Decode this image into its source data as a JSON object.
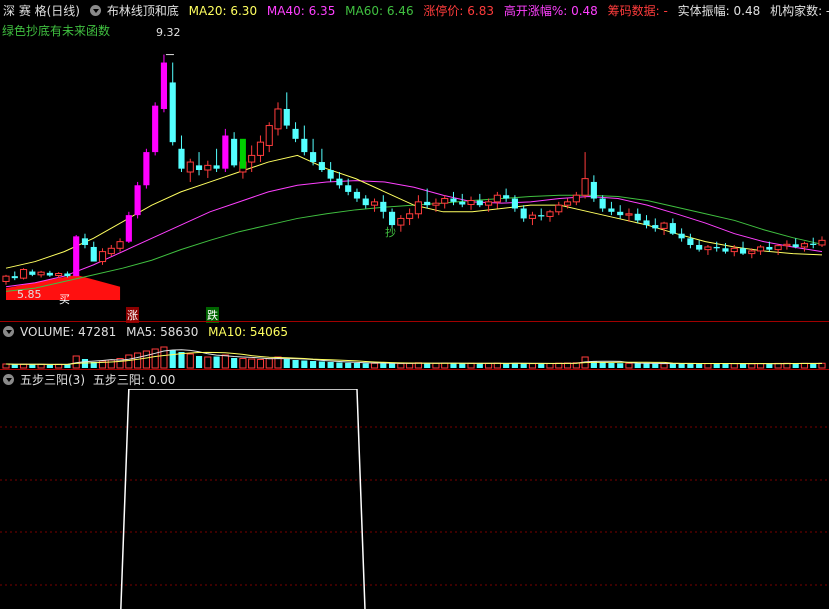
{
  "window": {
    "title": "深 赛 格(日线)"
  },
  "main_header": {
    "indicator": "布林线顶和底",
    "ma20": "MA20: 6.30",
    "ma40": "MA40: 6.35",
    "ma60": "MA60: 6.46",
    "limit_price": "涨停价: 6.83",
    "gap_pct": "高开涨幅%: 0.48",
    "chips": "筹码数据: -",
    "body_amp": "实体振幅: 0.48",
    "inst": "机构家数: -"
  },
  "main_note": "绿色抄底有未来函数",
  "colors": {
    "up": "#ff3c3c",
    "down": "#54ffff",
    "ma20": "#ffff60",
    "ma40": "#ff40ff",
    "ma60": "#40c040",
    "strong_up": "#ff00ff",
    "vol_ma10": "#ffff60"
  },
  "annotations": {
    "high": "9.32",
    "low": "5.85",
    "buy": "买",
    "rise": "涨",
    "fall": "跌",
    "bottom": "抄"
  },
  "volume_header": {
    "title": "VOLUME: 47281",
    "ma5": "MA5: 58630",
    "ma10": "MA10: 54065"
  },
  "sub_header": {
    "title": "五步三阳(3)",
    "value": "五步三阳: 0.00"
  },
  "chart_data": [
    {
      "type": "candlestick",
      "ylim": [
        5.5,
        9.6
      ],
      "ohlc": [
        [
          5.9,
          6.0,
          5.85,
          5.98
        ],
        [
          5.98,
          6.05,
          5.92,
          5.95
        ],
        [
          5.95,
          6.1,
          5.93,
          6.08
        ],
        [
          6.05,
          6.08,
          5.98,
          6.0
        ],
        [
          6.0,
          6.06,
          5.96,
          6.04
        ],
        [
          6.03,
          6.06,
          5.97,
          5.99
        ],
        [
          5.99,
          6.04,
          5.95,
          6.02
        ],
        [
          6.02,
          6.05,
          5.96,
          5.98
        ],
        [
          5.98,
          6.6,
          5.98,
          6.58
        ],
        [
          6.55,
          6.62,
          6.4,
          6.45
        ],
        [
          6.42,
          6.5,
          6.35,
          6.2
        ],
        [
          6.2,
          6.4,
          6.15,
          6.35
        ],
        [
          6.32,
          6.45,
          6.28,
          6.4
        ],
        [
          6.4,
          6.55,
          6.35,
          6.5
        ],
        [
          6.5,
          6.95,
          6.48,
          6.9
        ],
        [
          6.9,
          7.4,
          6.85,
          7.35
        ],
        [
          7.35,
          7.9,
          7.3,
          7.85
        ],
        [
          7.85,
          8.6,
          7.8,
          8.55
        ],
        [
          8.5,
          9.32,
          8.45,
          9.2
        ],
        [
          8.9,
          9.2,
          7.95,
          8.0
        ],
        [
          7.9,
          8.1,
          7.55,
          7.6
        ],
        [
          7.55,
          7.75,
          7.4,
          7.7
        ],
        [
          7.65,
          7.85,
          7.5,
          7.58
        ],
        [
          7.58,
          7.72,
          7.46,
          7.65
        ],
        [
          7.65,
          7.9,
          7.55,
          7.6
        ],
        [
          7.6,
          8.2,
          7.55,
          8.1
        ],
        [
          8.05,
          8.15,
          7.62,
          7.65
        ],
        [
          7.55,
          7.8,
          7.45,
          7.7
        ],
        [
          7.7,
          7.95,
          7.55,
          7.8
        ],
        [
          7.8,
          8.1,
          7.7,
          8.0
        ],
        [
          7.95,
          8.3,
          7.85,
          8.25
        ],
        [
          8.2,
          8.6,
          8.1,
          8.5
        ],
        [
          8.5,
          8.75,
          8.2,
          8.25
        ],
        [
          8.2,
          8.3,
          8.0,
          8.05
        ],
        [
          8.05,
          8.25,
          7.8,
          7.85
        ],
        [
          7.85,
          8.05,
          7.65,
          7.7
        ],
        [
          7.7,
          7.9,
          7.55,
          7.58
        ],
        [
          7.58,
          7.7,
          7.4,
          7.45
        ],
        [
          7.45,
          7.55,
          7.3,
          7.35
        ],
        [
          7.35,
          7.45,
          7.2,
          7.25
        ],
        [
          7.25,
          7.3,
          7.1,
          7.15
        ],
        [
          7.15,
          7.2,
          7.0,
          7.05
        ],
        [
          7.05,
          7.15,
          6.95,
          7.1
        ],
        [
          7.1,
          7.2,
          6.85,
          6.95
        ],
        [
          6.95,
          7.0,
          6.7,
          6.75
        ],
        [
          6.75,
          6.9,
          6.65,
          6.85
        ],
        [
          6.85,
          7.0,
          6.75,
          6.92
        ],
        [
          6.92,
          7.2,
          6.85,
          7.1
        ],
        [
          7.1,
          7.3,
          7.0,
          7.05
        ],
        [
          7.05,
          7.15,
          6.95,
          7.08
        ],
        [
          7.08,
          7.2,
          7.0,
          7.15
        ],
        [
          7.15,
          7.25,
          7.05,
          7.1
        ],
        [
          7.1,
          7.22,
          7.02,
          7.06
        ],
        [
          7.06,
          7.18,
          6.98,
          7.12
        ],
        [
          7.12,
          7.22,
          7.02,
          7.05
        ],
        [
          7.05,
          7.15,
          6.95,
          7.1
        ],
        [
          7.1,
          7.25,
          7.0,
          7.2
        ],
        [
          7.2,
          7.3,
          7.1,
          7.15
        ],
        [
          7.15,
          7.2,
          6.95,
          7.0
        ],
        [
          7.0,
          7.05,
          6.8,
          6.85
        ],
        [
          6.85,
          6.95,
          6.75,
          6.9
        ],
        [
          6.9,
          7.0,
          6.82,
          6.88
        ],
        [
          6.88,
          6.98,
          6.8,
          6.95
        ],
        [
          6.95,
          7.1,
          6.9,
          7.05
        ],
        [
          7.05,
          7.15,
          7.0,
          7.1
        ],
        [
          7.1,
          7.25,
          7.05,
          7.2
        ],
        [
          7.2,
          7.85,
          7.15,
          7.45
        ],
        [
          7.4,
          7.5,
          7.1,
          7.15
        ],
        [
          7.15,
          7.2,
          6.95,
          7.0
        ],
        [
          7.0,
          7.1,
          6.9,
          6.95
        ],
        [
          6.95,
          7.05,
          6.85,
          6.9
        ],
        [
          6.9,
          7.0,
          6.8,
          6.92
        ],
        [
          6.92,
          7.0,
          6.78,
          6.82
        ],
        [
          6.82,
          6.9,
          6.7,
          6.75
        ],
        [
          6.75,
          6.85,
          6.65,
          6.7
        ],
        [
          6.7,
          6.8,
          6.6,
          6.78
        ],
        [
          6.78,
          6.85,
          6.6,
          6.62
        ],
        [
          6.62,
          6.7,
          6.5,
          6.55
        ],
        [
          6.55,
          6.62,
          6.4,
          6.45
        ],
        [
          6.45,
          6.52,
          6.35,
          6.38
        ],
        [
          6.38,
          6.45,
          6.3,
          6.42
        ],
        [
          6.42,
          6.5,
          6.35,
          6.4
        ],
        [
          6.4,
          6.48,
          6.32,
          6.35
        ],
        [
          6.35,
          6.45,
          6.28,
          6.4
        ],
        [
          6.4,
          6.5,
          6.3,
          6.32
        ],
        [
          6.32,
          6.4,
          6.25,
          6.36
        ],
        [
          6.36,
          6.45,
          6.3,
          6.42
        ],
        [
          6.42,
          6.5,
          6.35,
          6.38
        ],
        [
          6.38,
          6.46,
          6.3,
          6.44
        ],
        [
          6.44,
          6.52,
          6.38,
          6.46
        ],
        [
          6.46,
          6.55,
          6.4,
          6.42
        ],
        [
          6.42,
          6.5,
          6.35,
          6.47
        ],
        [
          6.47,
          6.56,
          6.4,
          6.45
        ],
        [
          6.45,
          6.58,
          6.42,
          6.52
        ]
      ],
      "ma20_line": [
        6.1,
        6.2,
        6.35,
        6.55,
        6.8,
        7.05,
        7.25,
        7.4,
        7.55,
        7.7,
        7.8,
        7.6,
        7.45,
        7.25,
        7.05,
        6.95,
        6.95,
        7.0,
        7.05,
        7.05,
        6.95,
        6.85,
        6.75,
        6.62,
        6.5,
        6.42,
        6.36,
        6.32,
        6.3
      ],
      "ma40_line": [
        5.82,
        5.88,
        5.98,
        6.15,
        6.35,
        6.55,
        6.75,
        6.95,
        7.1,
        7.25,
        7.35,
        7.4,
        7.42,
        7.4,
        7.32,
        7.2,
        7.1,
        7.08,
        7.1,
        7.15,
        7.18,
        7.15,
        7.05,
        6.92,
        6.78,
        6.62,
        6.5,
        6.42,
        6.35
      ],
      "ma60_line": [
        5.75,
        5.8,
        5.9,
        6.0,
        6.1,
        6.22,
        6.38,
        6.52,
        6.65,
        6.75,
        6.85,
        6.92,
        6.98,
        7.02,
        7.05,
        7.08,
        7.12,
        7.15,
        7.18,
        7.2,
        7.2,
        7.18,
        7.12,
        7.02,
        6.92,
        6.82,
        6.68,
        6.56,
        6.46
      ]
    },
    {
      "type": "bar",
      "title": "VOLUME: 47281",
      "ylim": [
        0,
        260000
      ],
      "values": [
        40000,
        36000,
        38000,
        35000,
        36000,
        34000,
        36000,
        38000,
        120000,
        90000,
        60000,
        70000,
        80000,
        95000,
        130000,
        150000,
        170000,
        190000,
        210000,
        180000,
        160000,
        140000,
        120000,
        110000,
        115000,
        130000,
        100000,
        95000,
        90000,
        85000,
        95000,
        110000,
        90000,
        80000,
        75000,
        70000,
        65000,
        60000,
        55000,
        52000,
        50000,
        48000,
        47000,
        50000,
        45000,
        44000,
        46000,
        52000,
        49000,
        47000,
        48000,
        46000,
        45000,
        47000,
        46000,
        45000,
        48000,
        47000,
        50000,
        45000,
        44000,
        43000,
        45000,
        48000,
        50000,
        52000,
        110000,
        70000,
        55000,
        50000,
        48000,
        47000,
        46000,
        45000,
        44000,
        43000,
        44000,
        46000,
        48000,
        45000,
        44000,
        43000,
        45000,
        44000,
        43000,
        42000,
        44000,
        45000,
        46000,
        47000,
        45000,
        46000,
        47000,
        47281
      ],
      "up": [
        1,
        0,
        1,
        0,
        1,
        0,
        1,
        0,
        1,
        0,
        0,
        1,
        1,
        1,
        1,
        1,
        1,
        1,
        1,
        0,
        0,
        1,
        0,
        1,
        0,
        1,
        0,
        1,
        1,
        1,
        1,
        1,
        0,
        0,
        0,
        0,
        0,
        0,
        0,
        0,
        0,
        0,
        1,
        0,
        0,
        1,
        1,
        1,
        0,
        1,
        1,
        0,
        0,
        1,
        0,
        1,
        1,
        0,
        0,
        0,
        1,
        0,
        1,
        1,
        1,
        1,
        1,
        0,
        0,
        0,
        0,
        1,
        0,
        0,
        0,
        1,
        0,
        0,
        0,
        0,
        1,
        0,
        0,
        1,
        0,
        1,
        1,
        0,
        1,
        1,
        0,
        1,
        0,
        1
      ]
    },
    {
      "type": "line",
      "title": "五步三阳(3)",
      "ylim": [
        0,
        1
      ],
      "x_start": 14,
      "x_end": 40,
      "value": 1
    }
  ]
}
